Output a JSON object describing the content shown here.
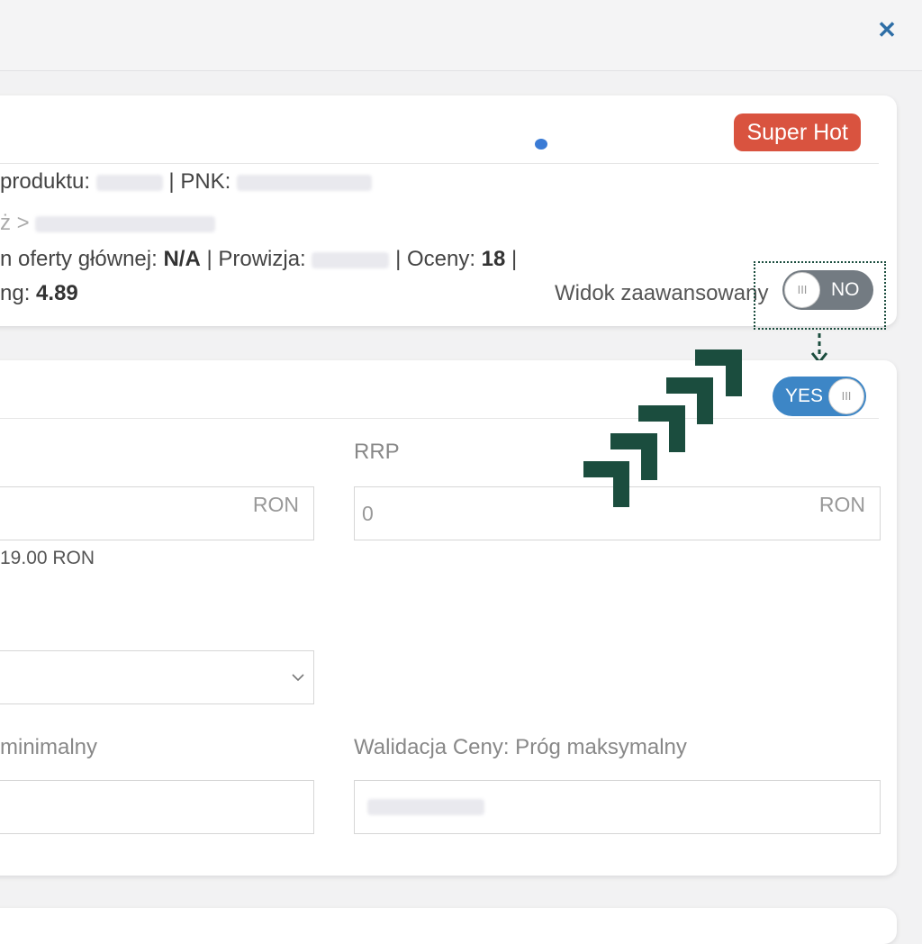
{
  "close_icon": "close-icon",
  "product": {
    "badge": "Super Hot",
    "id_label": "produktu:",
    "pnk_label": "| PNK:",
    "breadcrumb": "ż >",
    "main_offer_label": "n oferty głównej:",
    "main_offer_value": "N/A",
    "commission_label": "| Prowizja:",
    "ratings_label": "| Oceny:",
    "ratings_value": "18",
    "ratings_sep": "|",
    "rating_label": "ng:",
    "rating_value": "4.89"
  },
  "advanced_view": {
    "label": "Widok zaawansowany",
    "toggle_off": "NO",
    "toggle_on": "YES"
  },
  "form": {
    "price_unit": "RON",
    "price_note": "19.00 RON",
    "rrp_label": "RRP",
    "rrp_value": "0",
    "rrp_unit": "RON",
    "min_label": "minimalny",
    "max_label": "Walidacja Ceny: Próg maksymalny"
  },
  "colors": {
    "badge": "#d9533f",
    "toggle_on": "#3d86c6",
    "toggle_off": "#737b82",
    "annotation": "#1b4d3e"
  }
}
